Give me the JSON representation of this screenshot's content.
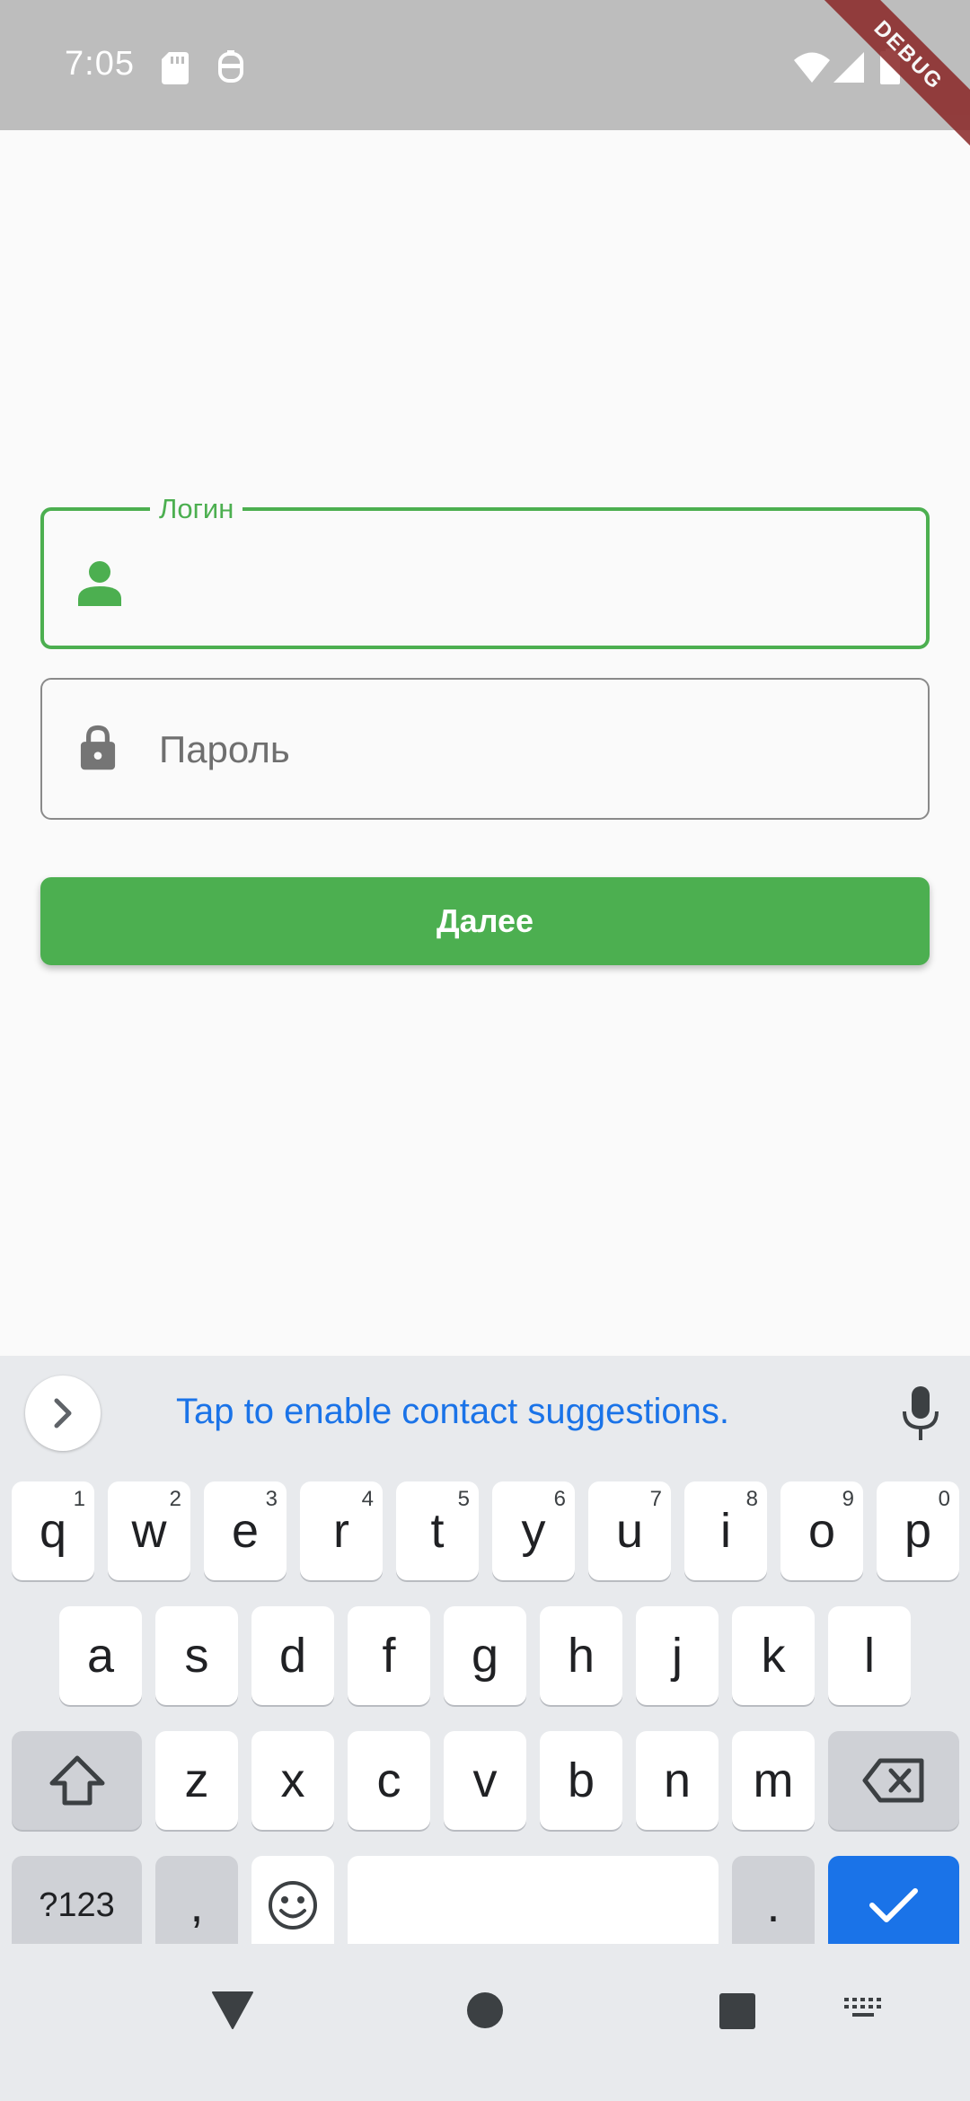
{
  "status_bar": {
    "time": "7:05",
    "icons": [
      "sd-card-icon",
      "robot-icon",
      "wifi-icon",
      "signal-icon",
      "battery-icon"
    ],
    "background": "#bdbdbd"
  },
  "debug_banner": "DEBUG",
  "form": {
    "login_label": "Логин",
    "login_value": "",
    "password_placeholder": "Пароль",
    "password_value": "",
    "next_button": "Далее",
    "accent_color": "#4caf50"
  },
  "keyboard": {
    "suggestion": "Tap to enable contact suggestions.",
    "row1": [
      {
        "k": "q",
        "s": "1"
      },
      {
        "k": "w",
        "s": "2"
      },
      {
        "k": "e",
        "s": "3"
      },
      {
        "k": "r",
        "s": "4"
      },
      {
        "k": "t",
        "s": "5"
      },
      {
        "k": "y",
        "s": "6"
      },
      {
        "k": "u",
        "s": "7"
      },
      {
        "k": "i",
        "s": "8"
      },
      {
        "k": "o",
        "s": "9"
      },
      {
        "k": "p",
        "s": "0"
      }
    ],
    "row2": [
      "a",
      "s",
      "d",
      "f",
      "g",
      "h",
      "j",
      "k",
      "l"
    ],
    "row3": [
      "z",
      "x",
      "c",
      "v",
      "b",
      "n",
      "m"
    ],
    "symbols_key": "?123",
    "comma_key": ",",
    "period_key": ".",
    "accent_color": "#1a73e8"
  },
  "nav_bar": {
    "icons": [
      "back-icon",
      "home-icon",
      "recents-icon",
      "keyboard-switch-icon"
    ]
  }
}
